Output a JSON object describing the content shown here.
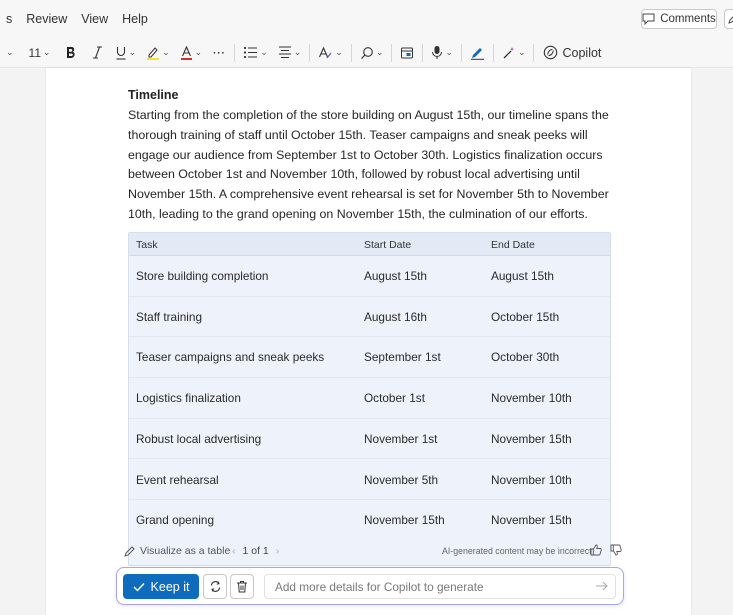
{
  "menubar": {
    "items": [
      "s",
      "Review",
      "View",
      "Help"
    ],
    "comments_label": "Comments"
  },
  "toolbar": {
    "font_size": "11",
    "copilot_label": "Copilot"
  },
  "document": {
    "heading": "Timeline",
    "paragraph": "Starting from the completion of the store building on August 15th, our timeline spans the thorough training of staff until October 15th. Teaser campaigns and sneak peeks will engage our audience from September 1st to October 30th. Logistics finalization occurs between October 1st and November 10th, followed by robust local advertising until November 15th. A comprehensive event rehearsal is set for November 5th to November 10th, leading to the grand opening on November 15th, the culmination of our efforts."
  },
  "table": {
    "headers": [
      "Task",
      "Start Date",
      "End Date"
    ],
    "rows": [
      [
        "Store building completion",
        "August 15th",
        "August 15th"
      ],
      [
        "Staff training",
        "August 16th",
        "October 15th"
      ],
      [
        "Teaser campaigns and sneak peeks",
        "September 1st",
        "October 30th"
      ],
      [
        "Logistics finalization",
        "October 1st",
        "November 10th"
      ],
      [
        "Robust local advertising",
        "November 1st",
        "November 15th"
      ],
      [
        "Event rehearsal",
        "November 5th",
        "November 10th"
      ],
      [
        "Grand opening",
        "November 15th",
        "November 15th"
      ]
    ]
  },
  "footer": {
    "visualize_label": "Visualize as a table",
    "pager": "1 of 1",
    "disclaimer": "AI-generated content may be incorrect"
  },
  "copilot": {
    "keep_label": "Keep it",
    "placeholder": "Add more details for Copilot to generate"
  },
  "colors": {
    "accent": "#0f6cbd",
    "table_bg": "#eef3fb",
    "copilot_border": "#a9a5e8"
  }
}
